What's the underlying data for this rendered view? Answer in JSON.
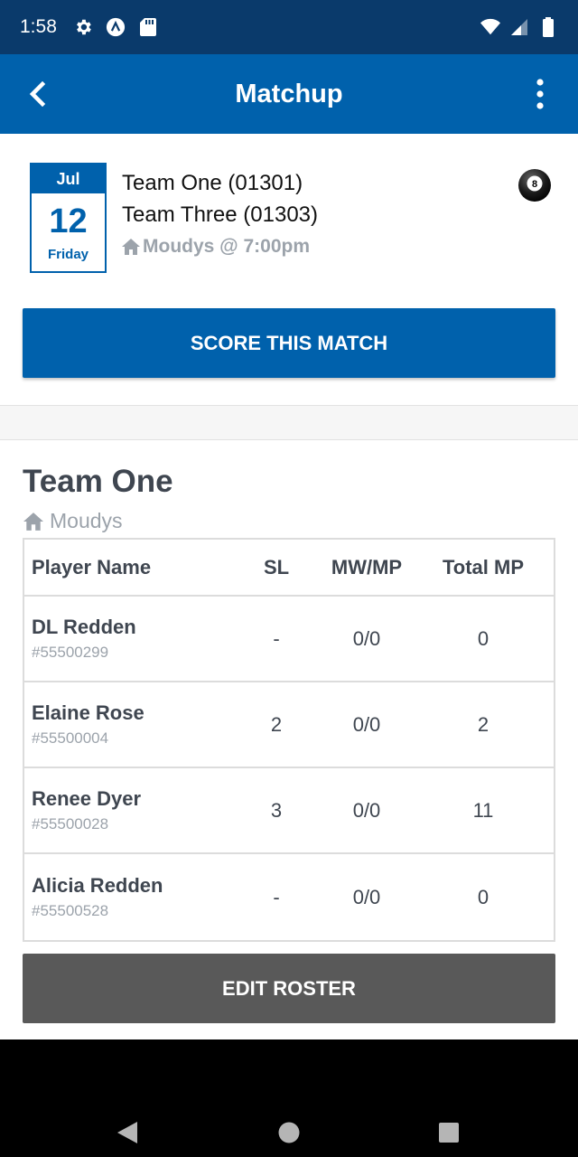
{
  "status_bar": {
    "time": "1:58",
    "icons_left": [
      "gear-icon",
      "app-icon",
      "sd-card-icon"
    ],
    "icons_right": [
      "wifi-icon",
      "signal-icon",
      "battery-icon"
    ]
  },
  "app_bar": {
    "title": "Matchup",
    "back_icon": "chevron-left-icon",
    "menu_icon": "more-vertical-icon",
    "background": "#0061ac"
  },
  "match": {
    "date": {
      "month": "Jul",
      "day": "12",
      "weekday": "Friday"
    },
    "home_team": "Team One (01301)",
    "away_team": "Team Three (01303)",
    "venue": "Moudys @ 7:00pm",
    "game_icon": "eight-ball-icon",
    "score_button": "SCORE THIS MATCH"
  },
  "team": {
    "name": "Team One",
    "venue": "Moudys"
  },
  "roster": {
    "headers": [
      "Player Name",
      "SL",
      "MW/MP",
      "Total MP"
    ],
    "rows": [
      {
        "name": "DL Redden",
        "number": "#55500299",
        "sl": "-",
        "mw_mp": "0/0",
        "total_mp": "0"
      },
      {
        "name": "Elaine Rose",
        "number": "#55500004",
        "sl": "2",
        "mw_mp": "0/0",
        "total_mp": "2"
      },
      {
        "name": "Renee Dyer",
        "number": "#55500028",
        "sl": "3",
        "mw_mp": "0/0",
        "total_mp": "11"
      },
      {
        "name": "Alicia Redden",
        "number": "#55500528",
        "sl": "-",
        "mw_mp": "0/0",
        "total_mp": "0"
      }
    ],
    "edit_button": "EDIT ROSTER"
  },
  "nav_bar": {
    "buttons": [
      "back-triangle-icon",
      "home-circle-icon",
      "recents-square-icon"
    ]
  },
  "colors": {
    "primary": "#0061ac",
    "status_bar": "#0a3a6b",
    "edit_button": "#595959",
    "muted_text": "#9ca3ab",
    "heading_text": "#3f4650"
  }
}
